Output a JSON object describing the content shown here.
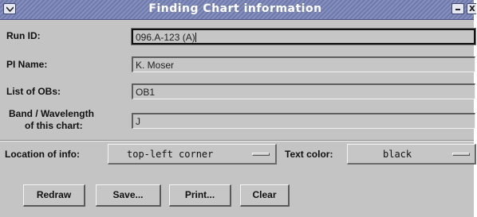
{
  "window": {
    "title": "Finding Chart information",
    "menu_icon": "chevron-down-icon",
    "minimize_icon": "minimize-icon",
    "close_icon": "close-icon",
    "close_glyph": "x"
  },
  "form": {
    "run_id": {
      "label": "Run ID:",
      "value": "096.A-123 (A)"
    },
    "pi_name": {
      "label": "PI Name:",
      "value": "K. Moser"
    },
    "obs": {
      "label": "List of OBs:",
      "value": "OB1"
    },
    "band": {
      "label_line1": "Band / Wavelength",
      "label_line2": "of this chart:",
      "value": "J"
    }
  },
  "options": {
    "location": {
      "label": "Location of info:",
      "value": "top-left corner"
    },
    "text_color": {
      "label": "Text color:",
      "value": "black"
    }
  },
  "buttons": {
    "redraw": "Redraw",
    "save": "Save...",
    "print": "Print...",
    "clear": "Clear"
  },
  "colors": {
    "titlebar": "#7b86b5",
    "background": "#c4c4c4"
  }
}
